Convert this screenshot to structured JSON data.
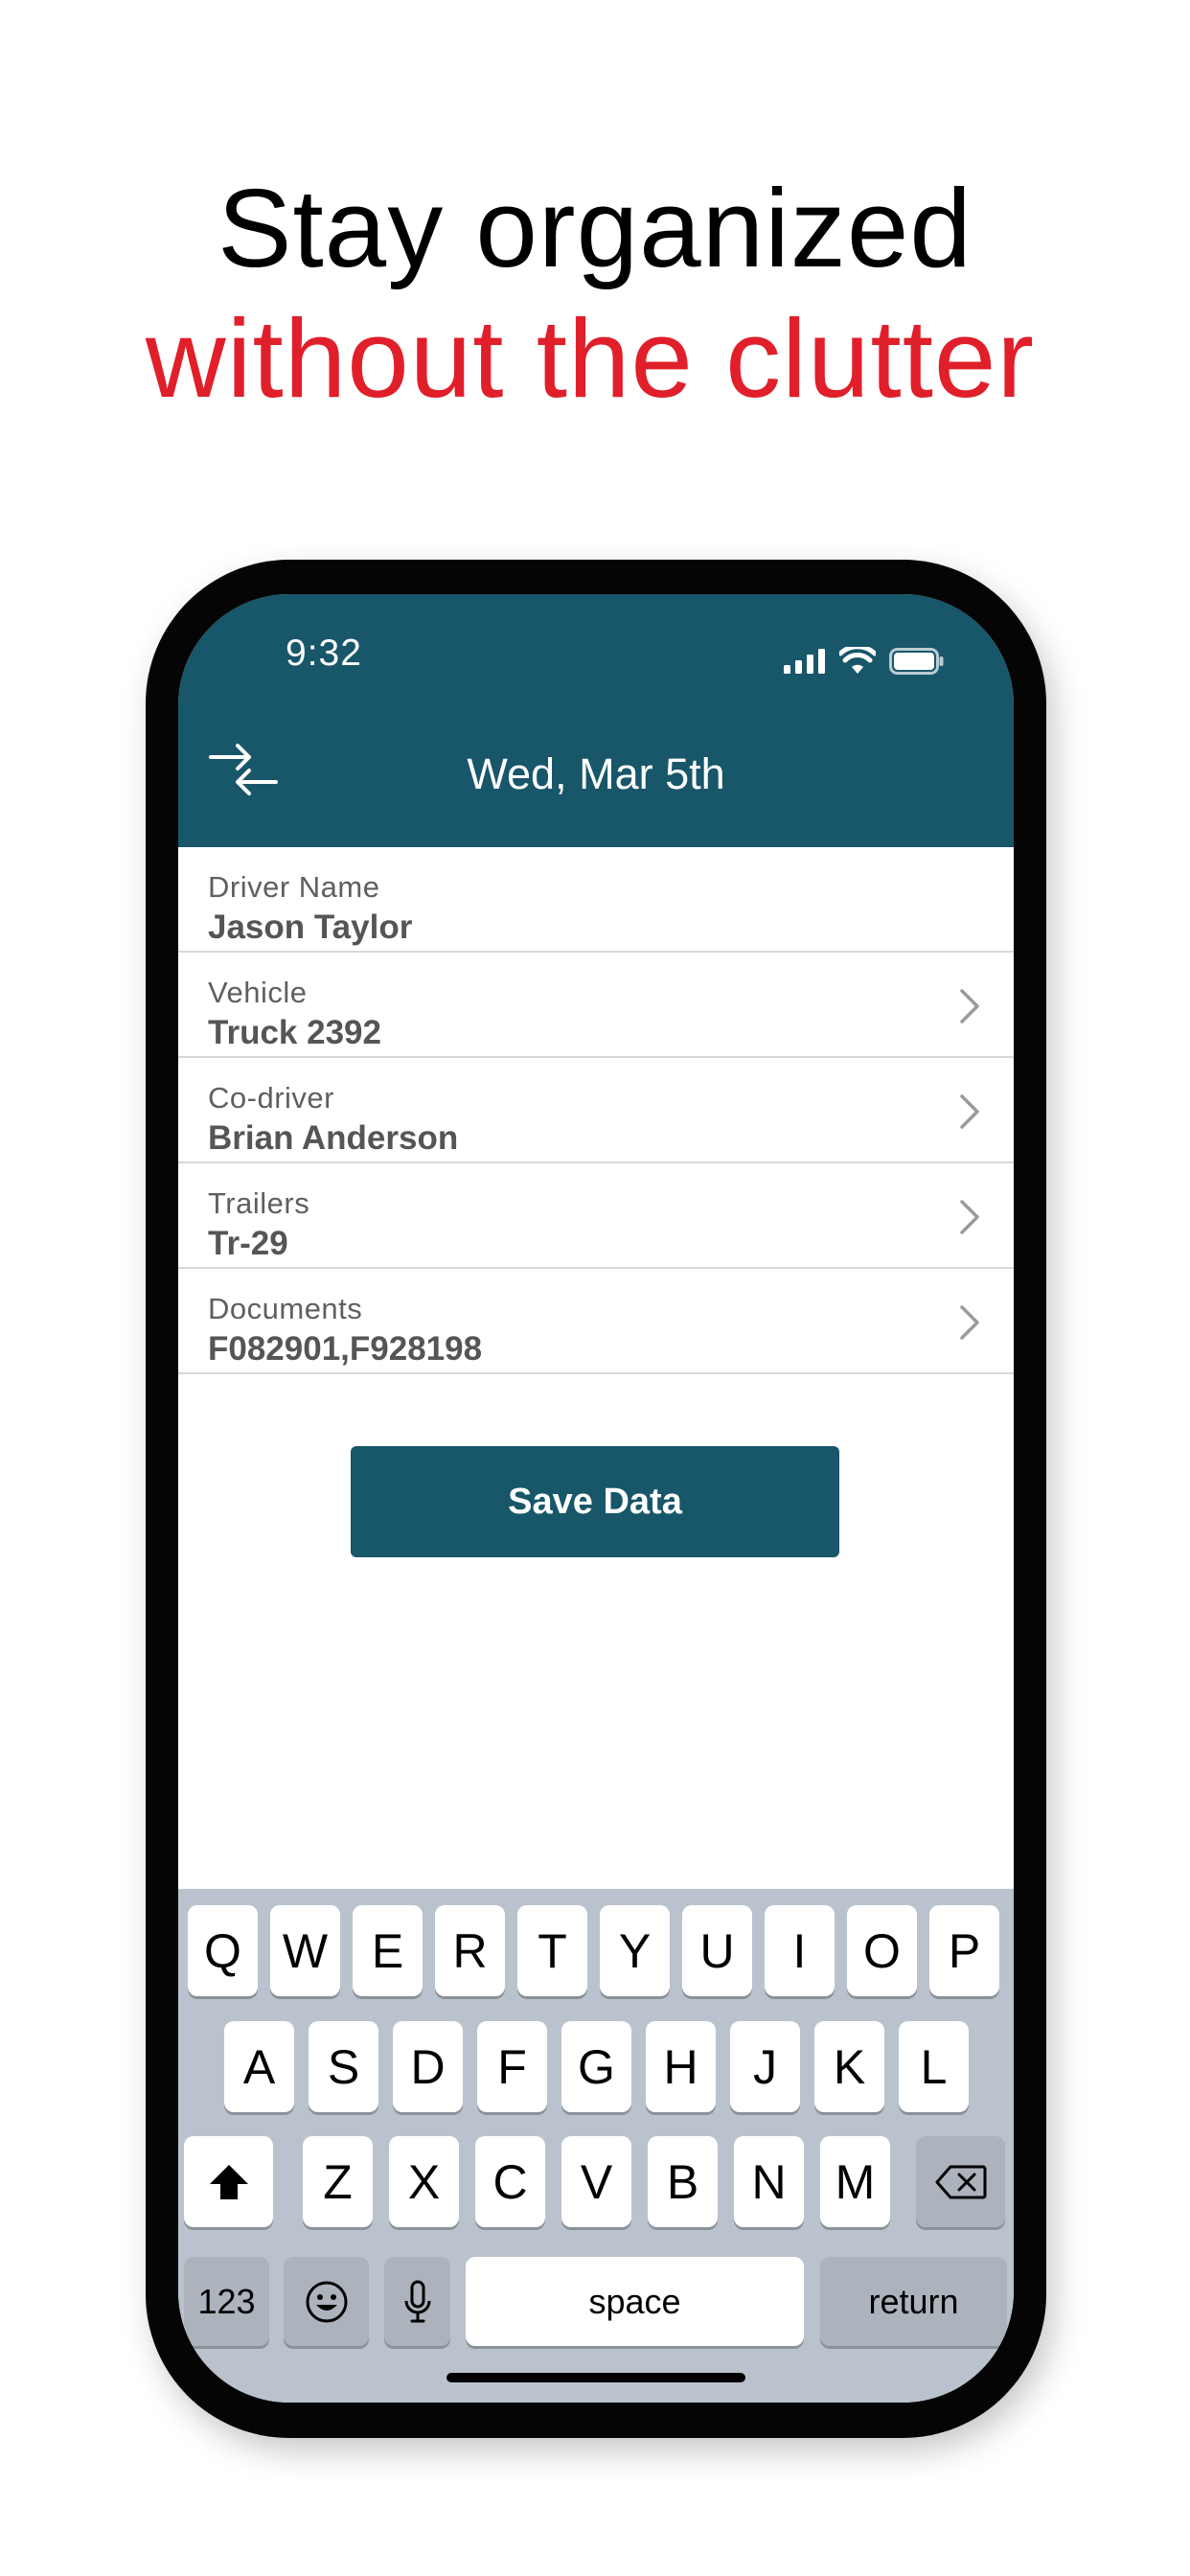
{
  "headline": {
    "line1": "Stay organized",
    "line2": "without the clutter"
  },
  "colors": {
    "accent_red": "#e01f2a",
    "brand_teal": "#18566a",
    "keyboard_bg": "#bac3cd"
  },
  "status_bar": {
    "time": "9:32",
    "icons": [
      "cellular-signal-icon",
      "wifi-icon",
      "battery-icon"
    ]
  },
  "header": {
    "title": "Wed, Mar 5th",
    "left_icon": "swap-arrows-icon"
  },
  "form": {
    "rows": [
      {
        "label": "Driver Name",
        "value": "Jason Taylor",
        "has_chevron": false
      },
      {
        "label": "Vehicle",
        "value": "Truck 2392",
        "has_chevron": true
      },
      {
        "label": "Co-driver",
        "value": "Brian Anderson",
        "has_chevron": true
      },
      {
        "label": "Trailers",
        "value": "Tr-29",
        "has_chevron": true
      },
      {
        "label": "Documents",
        "value": "F082901,F928198",
        "has_chevron": true
      }
    ]
  },
  "save_button": {
    "label": "Save Data"
  },
  "keyboard": {
    "row1": [
      "Q",
      "W",
      "E",
      "R",
      "T",
      "Y",
      "U",
      "I",
      "O",
      "P"
    ],
    "row2": [
      "A",
      "S",
      "D",
      "F",
      "G",
      "H",
      "J",
      "K",
      "L"
    ],
    "row3": [
      "Z",
      "X",
      "C",
      "V",
      "B",
      "N",
      "M"
    ],
    "numbers_label": "123",
    "space_label": "space",
    "return_label": "return"
  }
}
